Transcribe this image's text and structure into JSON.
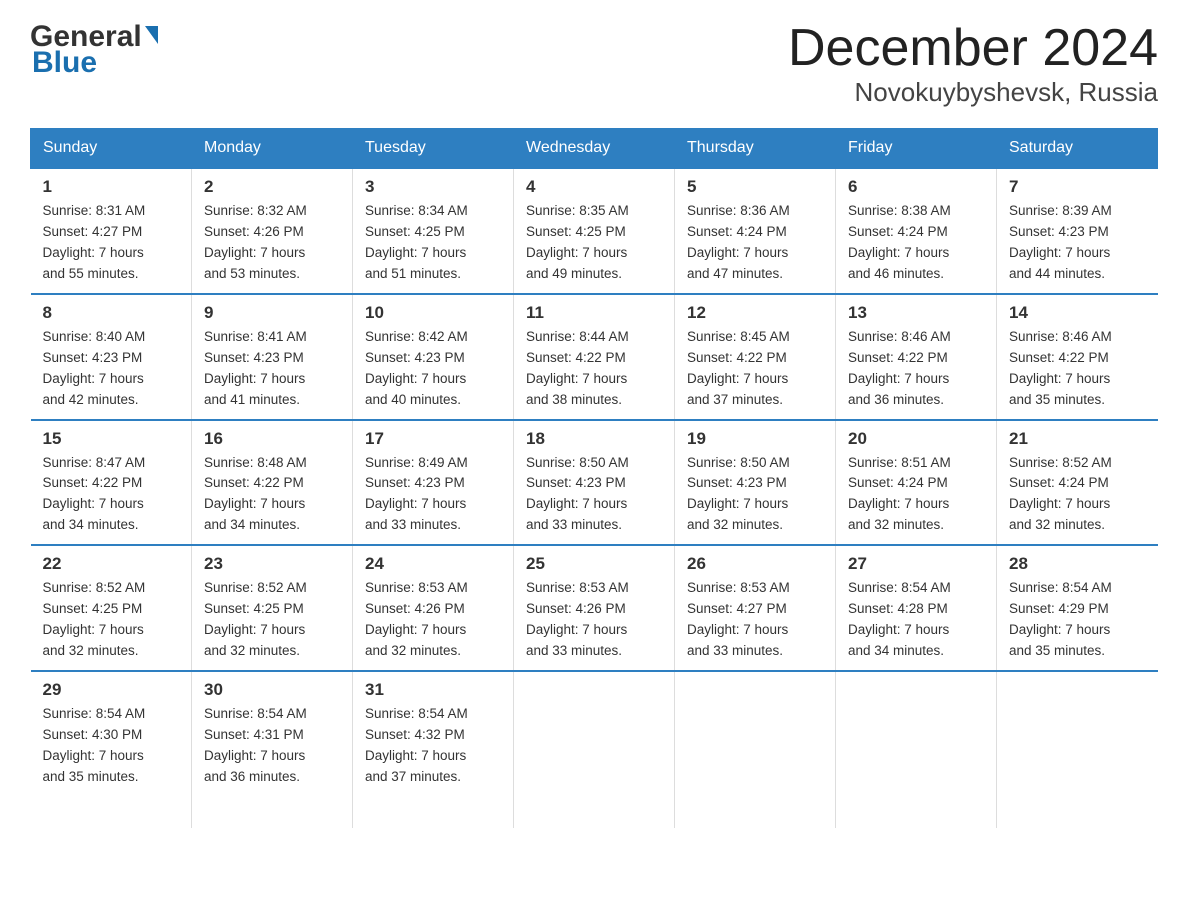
{
  "logo": {
    "general": "General",
    "blue": "Blue",
    "arrow_char": "▶"
  },
  "title": "December 2024",
  "subtitle": "Novokuybyshevsk, Russia",
  "days_header": [
    "Sunday",
    "Monday",
    "Tuesday",
    "Wednesday",
    "Thursday",
    "Friday",
    "Saturday"
  ],
  "weeks": [
    [
      {
        "day": "1",
        "sunrise": "8:31 AM",
        "sunset": "4:27 PM",
        "daylight": "7 hours and 55 minutes."
      },
      {
        "day": "2",
        "sunrise": "8:32 AM",
        "sunset": "4:26 PM",
        "daylight": "7 hours and 53 minutes."
      },
      {
        "day": "3",
        "sunrise": "8:34 AM",
        "sunset": "4:25 PM",
        "daylight": "7 hours and 51 minutes."
      },
      {
        "day": "4",
        "sunrise": "8:35 AM",
        "sunset": "4:25 PM",
        "daylight": "7 hours and 49 minutes."
      },
      {
        "day": "5",
        "sunrise": "8:36 AM",
        "sunset": "4:24 PM",
        "daylight": "7 hours and 47 minutes."
      },
      {
        "day": "6",
        "sunrise": "8:38 AM",
        "sunset": "4:24 PM",
        "daylight": "7 hours and 46 minutes."
      },
      {
        "day": "7",
        "sunrise": "8:39 AM",
        "sunset": "4:23 PM",
        "daylight": "7 hours and 44 minutes."
      }
    ],
    [
      {
        "day": "8",
        "sunrise": "8:40 AM",
        "sunset": "4:23 PM",
        "daylight": "7 hours and 42 minutes."
      },
      {
        "day": "9",
        "sunrise": "8:41 AM",
        "sunset": "4:23 PM",
        "daylight": "7 hours and 41 minutes."
      },
      {
        "day": "10",
        "sunrise": "8:42 AM",
        "sunset": "4:23 PM",
        "daylight": "7 hours and 40 minutes."
      },
      {
        "day": "11",
        "sunrise": "8:44 AM",
        "sunset": "4:22 PM",
        "daylight": "7 hours and 38 minutes."
      },
      {
        "day": "12",
        "sunrise": "8:45 AM",
        "sunset": "4:22 PM",
        "daylight": "7 hours and 37 minutes."
      },
      {
        "day": "13",
        "sunrise": "8:46 AM",
        "sunset": "4:22 PM",
        "daylight": "7 hours and 36 minutes."
      },
      {
        "day": "14",
        "sunrise": "8:46 AM",
        "sunset": "4:22 PM",
        "daylight": "7 hours and 35 minutes."
      }
    ],
    [
      {
        "day": "15",
        "sunrise": "8:47 AM",
        "sunset": "4:22 PM",
        "daylight": "7 hours and 34 minutes."
      },
      {
        "day": "16",
        "sunrise": "8:48 AM",
        "sunset": "4:22 PM",
        "daylight": "7 hours and 34 minutes."
      },
      {
        "day": "17",
        "sunrise": "8:49 AM",
        "sunset": "4:23 PM",
        "daylight": "7 hours and 33 minutes."
      },
      {
        "day": "18",
        "sunrise": "8:50 AM",
        "sunset": "4:23 PM",
        "daylight": "7 hours and 33 minutes."
      },
      {
        "day": "19",
        "sunrise": "8:50 AM",
        "sunset": "4:23 PM",
        "daylight": "7 hours and 32 minutes."
      },
      {
        "day": "20",
        "sunrise": "8:51 AM",
        "sunset": "4:24 PM",
        "daylight": "7 hours and 32 minutes."
      },
      {
        "day": "21",
        "sunrise": "8:52 AM",
        "sunset": "4:24 PM",
        "daylight": "7 hours and 32 minutes."
      }
    ],
    [
      {
        "day": "22",
        "sunrise": "8:52 AM",
        "sunset": "4:25 PM",
        "daylight": "7 hours and 32 minutes."
      },
      {
        "day": "23",
        "sunrise": "8:52 AM",
        "sunset": "4:25 PM",
        "daylight": "7 hours and 32 minutes."
      },
      {
        "day": "24",
        "sunrise": "8:53 AM",
        "sunset": "4:26 PM",
        "daylight": "7 hours and 32 minutes."
      },
      {
        "day": "25",
        "sunrise": "8:53 AM",
        "sunset": "4:26 PM",
        "daylight": "7 hours and 33 minutes."
      },
      {
        "day": "26",
        "sunrise": "8:53 AM",
        "sunset": "4:27 PM",
        "daylight": "7 hours and 33 minutes."
      },
      {
        "day": "27",
        "sunrise": "8:54 AM",
        "sunset": "4:28 PM",
        "daylight": "7 hours and 34 minutes."
      },
      {
        "day": "28",
        "sunrise": "8:54 AM",
        "sunset": "4:29 PM",
        "daylight": "7 hours and 35 minutes."
      }
    ],
    [
      {
        "day": "29",
        "sunrise": "8:54 AM",
        "sunset": "4:30 PM",
        "daylight": "7 hours and 35 minutes."
      },
      {
        "day": "30",
        "sunrise": "8:54 AM",
        "sunset": "4:31 PM",
        "daylight": "7 hours and 36 minutes."
      },
      {
        "day": "31",
        "sunrise": "8:54 AM",
        "sunset": "4:32 PM",
        "daylight": "7 hours and 37 minutes."
      },
      null,
      null,
      null,
      null
    ]
  ],
  "labels": {
    "sunrise": "Sunrise:",
    "sunset": "Sunset:",
    "daylight": "Daylight:"
  }
}
